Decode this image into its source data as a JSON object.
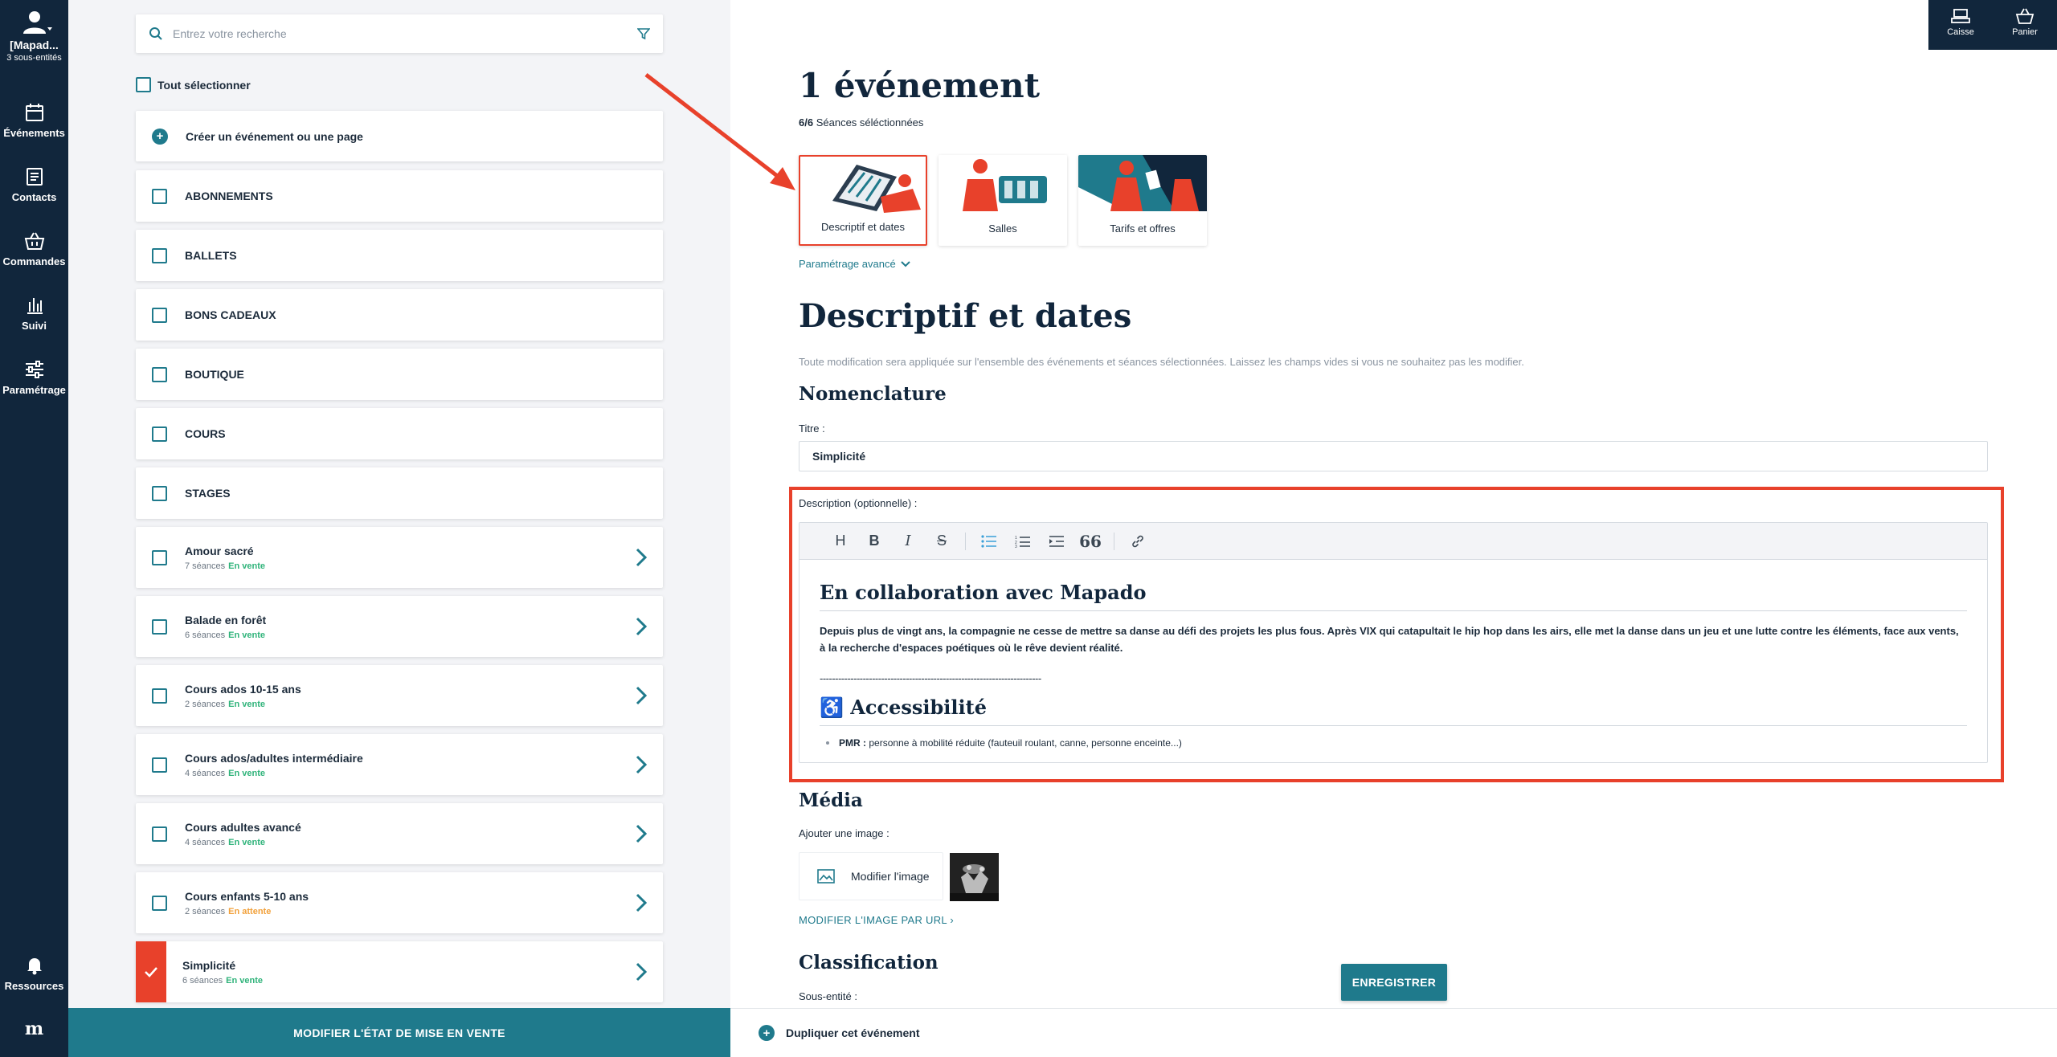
{
  "sidebar": {
    "user_name": "[Mapad...",
    "user_sub": "3 sous-entités",
    "items": [
      {
        "label": "Événements",
        "icon": "calendar-icon"
      },
      {
        "label": "Contacts",
        "icon": "contacts-icon"
      },
      {
        "label": "Commandes",
        "icon": "basket-icon"
      },
      {
        "label": "Suivi",
        "icon": "chart-icon"
      },
      {
        "label": "Paramétrage",
        "icon": "sliders-icon"
      }
    ],
    "resources_label": "Ressources",
    "logo": "m"
  },
  "list": {
    "search_placeholder": "Entrez votre recherche",
    "select_all": "Tout sélectionner",
    "create_label": "Créer un événement ou une page",
    "categories": [
      "ABONNEMENTS",
      "BALLETS",
      "BONS CADEAUX",
      "BOUTIQUE",
      "COURS",
      "STAGES"
    ],
    "events": [
      {
        "title": "Amour sacré",
        "sessions": "7 séances",
        "status": "En vente"
      },
      {
        "title": "Balade en forêt",
        "sessions": "6 séances",
        "status": "En vente"
      },
      {
        "title": "Cours ados 10-15 ans",
        "sessions": "2 séances",
        "status": "En vente"
      },
      {
        "title": "Cours ados/adultes intermédiaire",
        "sessions": "4 séances",
        "status": "En vente"
      },
      {
        "title": "Cours adultes avancé",
        "sessions": "4 séances",
        "status": "En vente"
      },
      {
        "title": "Cours enfants 5-10 ans",
        "sessions": "2 séances",
        "status": "En attente"
      },
      {
        "title": "Simplicité",
        "sessions": "6 séances",
        "status": "En vente"
      }
    ],
    "bottom_button": "MODIFIER L'ÉTAT DE MISE EN VENTE"
  },
  "topbar": {
    "caisse": "Caisse",
    "panier": "Panier"
  },
  "main": {
    "title": "1 événement",
    "selected_count": "6/6",
    "selected_label": "Séances séléctionnées",
    "tiles": [
      {
        "label": "Descriptif et dates",
        "active": true
      },
      {
        "label": "Salles",
        "active": false
      },
      {
        "label": "Tarifs et offres",
        "active": false
      }
    ],
    "advanced": "Paramétrage avancé",
    "section_title": "Descriptif et dates",
    "note": "Toute modification sera appliquée sur l'ensemble des événements et séances sélectionnées. Laissez les champs vides si vous ne souhaitez pas les modifier.",
    "nomenclature": "Nomenclature",
    "title_label": "Titre :",
    "title_value": "Simplicité",
    "description_label": "Description (optionnelle) :",
    "editor": {
      "heading": "En collaboration avec Mapado",
      "paragraph": "Depuis plus de vingt ans, la compagnie ne cesse de mettre sa danse au défi des projets les plus fous. Après VIX qui catapultait le hip hop dans les airs, elle met la danse dans un jeu et une lutte contre les éléments, face aux vents, à la recherche d'espaces poétiques où le rêve devient réalité.",
      "divider": "------------------------------------------------------------------------",
      "heading2": "♿ Accessibilité",
      "list_bold": "PMR :",
      "list_text": "personne à mobilité réduite (fauteuil roulant, canne, personne enceinte...)"
    },
    "media": "Média",
    "add_image_label": "Ajouter une image :",
    "modify_image": "Modifier l'image",
    "modify_url": "MODIFIER L'IMAGE PAR URL",
    "classification": "Classification",
    "subentity_label": "Sous-entité :",
    "save": "ENREGISTRER",
    "duplicate": "Dupliquer cet événement"
  },
  "colors": {
    "navy": "#11263c",
    "teal": "#1f7a8c",
    "red": "#e8412b",
    "green": "#2fb37a",
    "orange": "#f2a13b"
  }
}
